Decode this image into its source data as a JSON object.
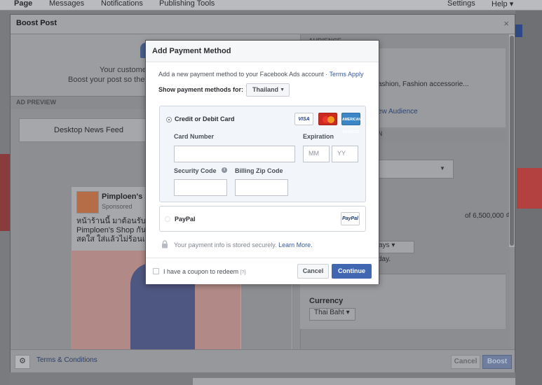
{
  "topnav": {
    "items": [
      "Page",
      "Messages",
      "Notifications",
      "Publishing Tools"
    ],
    "settings": "Settings",
    "help": "Help",
    "help_arrow": "▾"
  },
  "boost": {
    "title": "Boost Post",
    "close": "×",
    "intro_line1": "Your customer",
    "intro_line2": "Boost your post so they",
    "ad_preview": "AD PREVIEW",
    "feed_tab": "Desktop News Feed",
    "post_name": "Pimploen's S",
    "post_sponsored": "Sponsored",
    "post_text_line1": "หน้าร้านนี้ มาต้อนรับลม",
    "post_text_line2": "Pimploen's Shop กันดี",
    "post_text_line3": "สดใส ใส่แล้วไม่ร้อนแถ",
    "audience_header": "AUDIENCE",
    "audience_text": "ashion, Fashion accessorie...",
    "new_audience": "ew Audience",
    "section_header": "N",
    "budget_text": "of 6,500,000 ₫",
    "days_select": "ays",
    "day_text": "day.",
    "currency_label": "Currency",
    "currency_value": "Thai Baht",
    "terms": "Terms & Conditions",
    "cancel": "Cancel",
    "boost": "Boost"
  },
  "modal": {
    "title": "Add Payment Method",
    "intro_text": "Add a new payment method to your Facebook Ads account · ",
    "terms_link": "Terms Apply",
    "show_methods_label": "Show payment methods for:",
    "country": "Thailand",
    "credit_card_label": "Credit or Debit Card",
    "card_logos": {
      "visa": "VISA",
      "amex": "AMERICAN EXPRESS"
    },
    "card_number_label": "Card Number",
    "expiration_label": "Expiration",
    "month_placeholder": "MM",
    "year_placeholder": "YY",
    "security_code_label": "Security Code",
    "billing_zip_label": "Billing Zip Code",
    "paypal_label": "PayPal",
    "paypal_logo": "PayPal",
    "secure_text": "Your payment info is stored securely. ",
    "learn_more": "Learn More.",
    "coupon_label": "I have a coupon to redeem ",
    "coupon_help": "[?]",
    "cancel_button": "Cancel",
    "continue_button": "Continue"
  }
}
